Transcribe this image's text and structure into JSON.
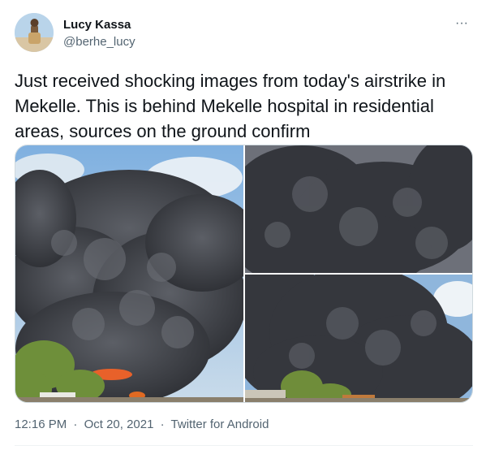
{
  "author": {
    "display_name": "Lucy Kassa",
    "handle": "@berhe_lucy"
  },
  "menu": {
    "more_label": "···",
    "more_icon": "more-horizontal-icon"
  },
  "tweet": {
    "text": "Just received shocking images from today's airstrike in Mekelle. This is behind Mekelle hospital in residential areas, sources on the ground confirm"
  },
  "media": {
    "photo_count": 3
  },
  "meta": {
    "time": "12:16 PM",
    "separator": "·",
    "date": "Oct 20, 2021",
    "source": "Twitter for Android"
  },
  "colors": {
    "text_primary": "#0f1419",
    "text_secondary": "#536471",
    "border": "#cfd9de",
    "smoke": "#3d3f45",
    "sky": "#8fb6dc"
  }
}
